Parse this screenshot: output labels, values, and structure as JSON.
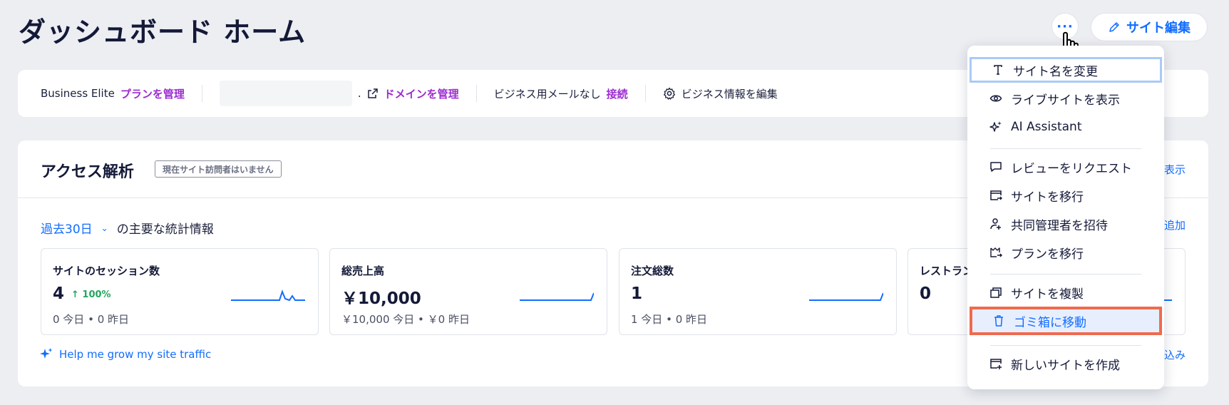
{
  "header": {
    "title": "ダッシュボード ホーム",
    "more_label": "···",
    "edit_site_label": "サイト編集"
  },
  "plan_bar": {
    "plan_name": "Business Elite",
    "manage_plan": "プランを管理",
    "domain_suffix": ".",
    "manage_domain": "ドメインを管理",
    "email_status": "ビジネス用メールなし",
    "connect": "接続",
    "edit_business_info": "ビジネス情報を編集"
  },
  "analytics": {
    "title": "アクセス解析",
    "badge": "現在サイト訪問者はいません",
    "view_link": "表示",
    "period": "過去30日",
    "period_suffix": "の主要な統計情報",
    "add_link": "追加",
    "help_link": "Help me grow my site traffic",
    "bottom_right_link": "込み",
    "cards": [
      {
        "label": "サイトのセッション数",
        "value": "4",
        "trend": "↑ 100%",
        "today": "0 今日",
        "yesterday": "0 昨日"
      },
      {
        "label": "総売上高",
        "value": "￥10,000",
        "trend": "",
        "today": "￥10,000 今日",
        "yesterday": "￥0 昨日"
      },
      {
        "label": "注文総数",
        "value": "1",
        "trend": "",
        "today": "1 今日",
        "yesterday": "0 昨日"
      },
      {
        "label": "レストラン",
        "value": "0",
        "trend": "",
        "today": "",
        "yesterday": ""
      }
    ]
  },
  "menu": {
    "items": [
      {
        "label": "サイト名を変更",
        "icon": "text-icon"
      },
      {
        "label": "ライブサイトを表示",
        "icon": "eye-icon"
      },
      {
        "label": "AI Assistant",
        "icon": "sparkle-icon"
      },
      {
        "label": "レビューをリクエスト",
        "icon": "comment-icon"
      },
      {
        "label": "サイトを移行",
        "icon": "transfer-site-icon"
      },
      {
        "label": "共同管理者を招待",
        "icon": "invite-user-icon"
      },
      {
        "label": "プランを移行",
        "icon": "transfer-plan-icon"
      },
      {
        "label": "サイトを複製",
        "icon": "duplicate-icon"
      },
      {
        "label": "ゴミ箱に移動",
        "icon": "trash-icon"
      },
      {
        "label": "新しいサイトを作成",
        "icon": "add-site-icon"
      }
    ]
  },
  "colors": {
    "accent": "#116dff",
    "plan_link": "#9c2cd1",
    "trend_up": "#25a55f",
    "highlight_border": "#f06a4e",
    "focus_border": "#a9cbf5",
    "page_bg": "#eceef2"
  }
}
